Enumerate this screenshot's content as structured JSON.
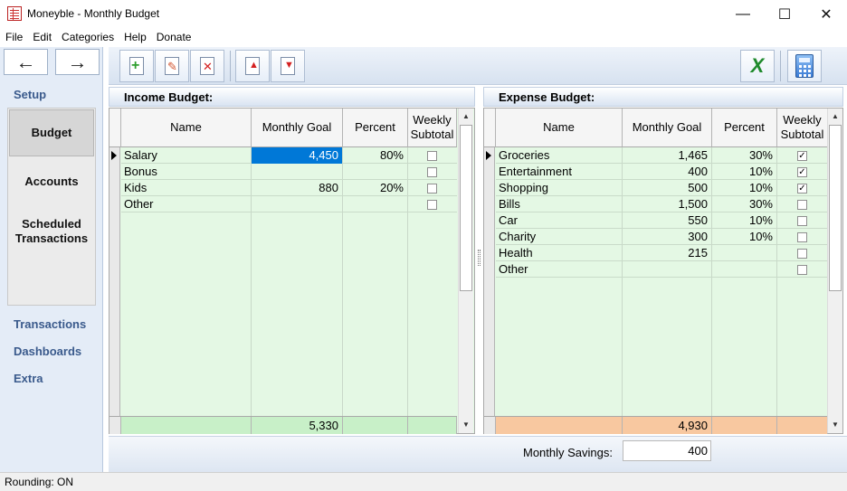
{
  "window": {
    "title": "Moneyble - Monthly Budget",
    "minimize_glyph": "—",
    "maximize_glyph": "☐",
    "close_glyph": "✕"
  },
  "menu": [
    "File",
    "Edit",
    "Categories",
    "Help",
    "Donate"
  ],
  "nav": {
    "back_glyph": "←",
    "forward_glyph": "→",
    "setup": "Setup",
    "budget": "Budget",
    "accounts": "Accounts",
    "scheduled_line1": "Scheduled",
    "scheduled_line2": "Transactions",
    "transactions": "Transactions",
    "dashboards": "Dashboards",
    "extra": "Extra"
  },
  "toolbar": {
    "icons": [
      "add-icon",
      "edit-icon",
      "delete-icon",
      "move-up-icon",
      "move-down-icon",
      "excel-export-icon",
      "calculator-icon"
    ],
    "add_glyph": "+",
    "edit_glyph": "✎",
    "delete_glyph": "✕",
    "up_glyph": "▲",
    "down_glyph": "▼",
    "excel_glyph": "X",
    "colors": {
      "add": "#2e9e2e",
      "edit": "#d0502a",
      "delete": "#d42020",
      "move": "#d42020",
      "excel": "#1f8a2c",
      "calculator": "#3a7bd5"
    }
  },
  "income": {
    "title": "Income Budget:",
    "headers": {
      "name": "Name",
      "goal": "Monthly Goal",
      "percent": "Percent",
      "weekly_line1": "Weekly",
      "weekly_line2": "Subtotal"
    },
    "rows": [
      {
        "name": "Salary",
        "goal": "4,450",
        "percent": "80%",
        "weekly": false
      },
      {
        "name": "Bonus",
        "goal": "",
        "percent": "",
        "weekly": false
      },
      {
        "name": "Kids",
        "goal": "880",
        "percent": "20%",
        "weekly": false
      },
      {
        "name": "Other",
        "goal": "",
        "percent": "",
        "weekly": false
      }
    ],
    "total": "5,330",
    "total_color": "#c8f0c8"
  },
  "expense": {
    "title": "Expense Budget:",
    "headers": {
      "name": "Name",
      "goal": "Monthly Goal",
      "percent": "Percent",
      "weekly_line1": "Weekly",
      "weekly_line2": "Subtotal"
    },
    "rows": [
      {
        "name": "Groceries",
        "goal": "1,465",
        "percent": "30%",
        "weekly": true
      },
      {
        "name": "Entertainment",
        "goal": "400",
        "percent": "10%",
        "weekly": true
      },
      {
        "name": "Shopping",
        "goal": "500",
        "percent": "10%",
        "weekly": true
      },
      {
        "name": "Bills",
        "goal": "1,500",
        "percent": "30%",
        "weekly": false
      },
      {
        "name": "Car",
        "goal": "550",
        "percent": "10%",
        "weekly": false
      },
      {
        "name": "Charity",
        "goal": "300",
        "percent": "10%",
        "weekly": false
      },
      {
        "name": "Health",
        "goal": "215",
        "percent": "",
        "weekly": false
      },
      {
        "name": "Other",
        "goal": "",
        "percent": "",
        "weekly": false
      }
    ],
    "total": "4,930",
    "total_color": "#f8c8a0"
  },
  "savings": {
    "label": "Monthly Savings:",
    "value": "400"
  },
  "status": {
    "text": "Rounding: ON"
  }
}
